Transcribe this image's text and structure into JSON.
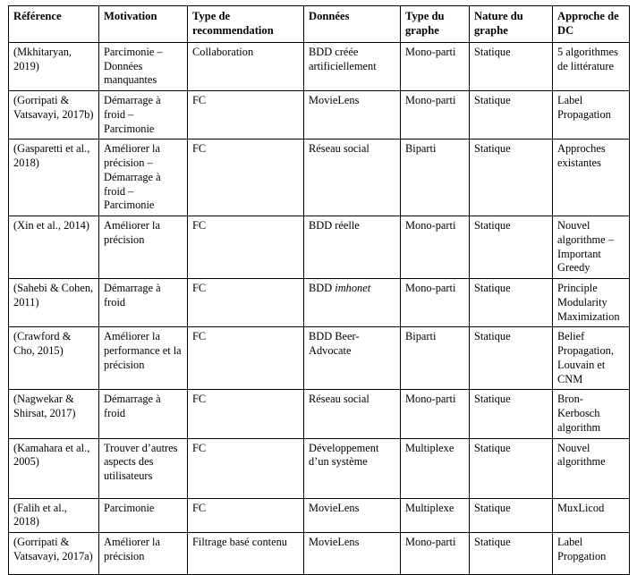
{
  "table": {
    "columns": [
      {
        "id": "reference",
        "label": "Référence"
      },
      {
        "id": "motivation",
        "label": "Motivation"
      },
      {
        "id": "type_reco",
        "label": "Type de recommendation"
      },
      {
        "id": "donnees",
        "label": "Données"
      },
      {
        "id": "type_graphe",
        "label": "Type du graphe"
      },
      {
        "id": "nature_graphe",
        "label": "Nature du graphe"
      },
      {
        "id": "approche_dc",
        "label": "Approche de DC"
      }
    ],
    "rows": [
      {
        "reference": "(Mkhitaryan, 2019)",
        "motivation": "Parcimonie – Données manquantes",
        "type_reco": "Collaboration",
        "donnees": "BDD créée artificiellement",
        "donnees_italic": "",
        "type_graphe": "Mono-parti",
        "nature_graphe": "Statique",
        "approche_dc": "5 algorithmes de littérature",
        "min_height": 52
      },
      {
        "reference": "(Gorripati & Vatsavayi, 2017b)",
        "motivation": "Démarrage à froid – Parcimonie",
        "type_reco": "FC",
        "donnees": "MovieLens",
        "donnees_italic": "",
        "type_graphe": "Mono-parti",
        "nature_graphe": "Statique",
        "approche_dc": "Label Propagation",
        "min_height": 48
      },
      {
        "reference": "(Gasparetti et al., 2018)",
        "motivation": "Améliorer la précision – Démarrage à froid – Parcimonie",
        "type_reco": "FC",
        "donnees": "Réseau social",
        "donnees_italic": "",
        "type_graphe": "Biparti",
        "nature_graphe": "Statique",
        "approche_dc": "Approches existantes",
        "min_height": 86
      },
      {
        "reference": "(Xin et al., 2014)",
        "motivation": "Améliorer la précision",
        "type_reco": "FC",
        "donnees": "BDD réelle",
        "donnees_italic": "",
        "type_graphe": "Mono-parti",
        "nature_graphe": "Statique",
        "approche_dc": "Nouvel algorithme – Important Greedy",
        "min_height": 68
      },
      {
        "reference": "(Sahebi & Cohen, 2011)",
        "motivation": "Démarrage à froid",
        "type_reco": "FC",
        "donnees": "BDD ",
        "donnees_italic": "imhonet",
        "type_graphe": "Mono-parti",
        "nature_graphe": "Statique",
        "approche_dc": "Principle Modularity Maximization",
        "min_height": 50
      },
      {
        "reference": "(Crawford & Cho, 2015)",
        "motivation": "Améliorer la performance et la précision",
        "type_reco": "FC",
        "donnees": "BDD Beer-Advocate",
        "donnees_italic": "",
        "type_graphe": "Biparti",
        "nature_graphe": "Statique",
        "approche_dc": "Belief Propagation, Louvain et CNM",
        "min_height": 68
      },
      {
        "reference": "(Nagwekar & Shirsat, 2017)",
        "motivation": "Démarrage à froid",
        "type_reco": "FC",
        "donnees": "Réseau social",
        "donnees_italic": "",
        "type_graphe": "Mono-parti",
        "nature_graphe": "Statique",
        "approche_dc": "Bron-Kerbosch algorithm",
        "min_height": 48
      },
      {
        "reference": "(Kamahara et al., 2005)",
        "motivation": "Trouver d’autres aspects des utilisateurs",
        "type_reco": "FC",
        "donnees": "Développement d’un système",
        "donnees_italic": "",
        "type_graphe": "Multiplexe",
        "nature_graphe": "Statique",
        "approche_dc": "Nouvel algorithme",
        "min_height": 68
      },
      {
        "reference": "(Falih et al., 2018)",
        "motivation": "Parcimonie",
        "type_reco": "FC",
        "donnees": "MovieLens",
        "donnees_italic": "",
        "type_graphe": "Multiplexe",
        "nature_graphe": "Statique",
        "approche_dc": "MuxLicod",
        "min_height": 33
      },
      {
        "reference": "(Gorripati & Vatsavayi, 2017a)",
        "motivation": "Améliorer la précision",
        "type_reco": "Filtrage basé contenu",
        "donnees": "MovieLens",
        "donnees_italic": "",
        "type_graphe": "Mono-parti",
        "nature_graphe": "Statique",
        "approche_dc": "Label Propgation",
        "min_height": 48
      }
    ]
  }
}
